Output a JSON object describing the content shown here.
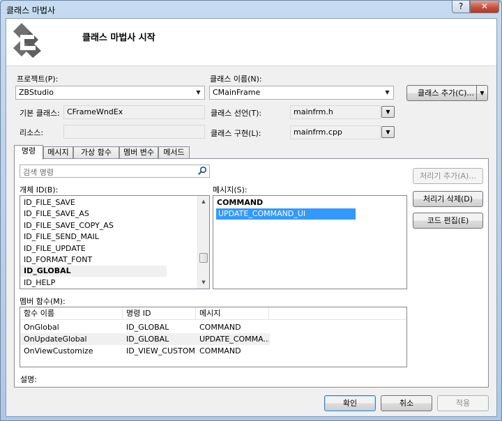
{
  "window": {
    "title": "클래스 마법사",
    "help_label": "?",
    "close_label": "✕"
  },
  "header": {
    "title": "클래스 마법사 시작",
    "logo_icon": "class-wizard-logo-icon"
  },
  "fields": {
    "project_label": "프로젝트(P):",
    "project_value": "ZBStudio",
    "class_name_label": "클래스 이름(N):",
    "class_name_value": "CMainFrame",
    "add_class_button": "클래스 추가(C)...",
    "base_class_label": "기본 클래스:",
    "base_class_value": "CFrameWndEx",
    "resource_label": "리소스:",
    "resource_value": "",
    "class_decl_label": "클래스 선언(T):",
    "class_decl_value": "mainfrm.h",
    "class_impl_label": "클래스 구현(L):",
    "class_impl_value": "mainfrm.cpp"
  },
  "tabs": [
    "명령",
    "메시지",
    "가상 함수",
    "멤버 변수",
    "메서드"
  ],
  "commands": {
    "search_placeholder": "검색 명령",
    "object_ids_label": "개체 ID(B):",
    "object_ids": [
      "ID_FILE_SAVE",
      "ID_FILE_SAVE_AS",
      "ID_FILE_SAVE_COPY_AS",
      "ID_FILE_SEND_MAIL",
      "ID_FILE_UPDATE",
      "ID_FORMAT_FONT",
      "ID_GLOBAL",
      "ID_HELP"
    ],
    "selected_object_id": "ID_GLOBAL",
    "messages_label": "메시지(S):",
    "messages": [
      "COMMAND",
      "UPDATE_COMMAND_UI"
    ],
    "selected_message": "UPDATE_COMMAND_UI",
    "add_handler_button": "처리기 추가(A)...",
    "delete_handler_button": "처리기 삭제(D)",
    "edit_code_button": "코드 편집(E)",
    "member_functions_label": "멤버 함수(M):",
    "columns": [
      "함수 이름",
      "명령 ID",
      "메시지"
    ],
    "rows": [
      [
        "OnGlobal",
        "ID_GLOBAL",
        "COMMAND"
      ],
      [
        "OnUpdateGlobal",
        "ID_GLOBAL",
        "UPDATE_COMMA..."
      ],
      [
        "OnViewCustomize",
        "ID_VIEW_CUSTOM...",
        "COMMAND"
      ]
    ],
    "description_label": "설명:"
  },
  "footer": {
    "ok": "확인",
    "cancel": "취소",
    "apply": "적용"
  },
  "colors": {
    "selection": "#3399ff",
    "title_bg": "#b9d1ea",
    "close_red": "#c5533c"
  }
}
